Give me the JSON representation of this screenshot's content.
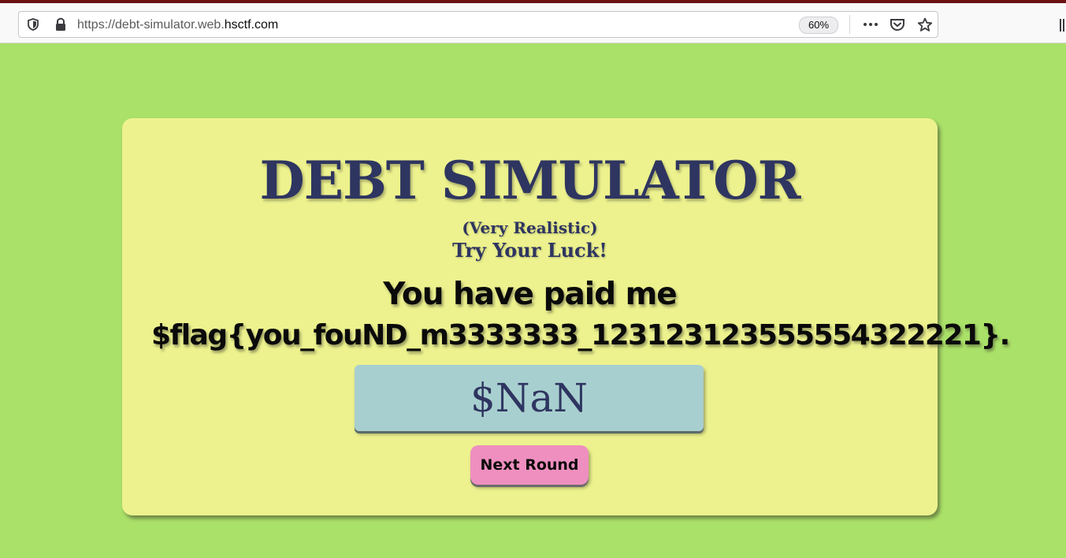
{
  "browser": {
    "url_prefix": "https://debt-simulator.web.",
    "url_host": "hsctf.com",
    "zoom": "60%",
    "icons": [
      "shield-icon",
      "lock-icon",
      "more-actions-icon",
      "pocket-icon",
      "bookmark-star-icon",
      "library-icon"
    ]
  },
  "page": {
    "title": "DEBT SIMULATOR",
    "subtitle": "(Very Realistic)",
    "tagline": "Try Your Luck!",
    "message_line1": "You have paid me",
    "message_line2": "$flag{you_fouND_m3333333_123123123555554322221}.",
    "amount": "$NaN",
    "next_button": "Next Round"
  },
  "colors": {
    "background": "#aae169",
    "card": "#edf28e",
    "title": "#2e3560",
    "amount_box": "#a8cfcf",
    "button": "#ef8fbf"
  }
}
